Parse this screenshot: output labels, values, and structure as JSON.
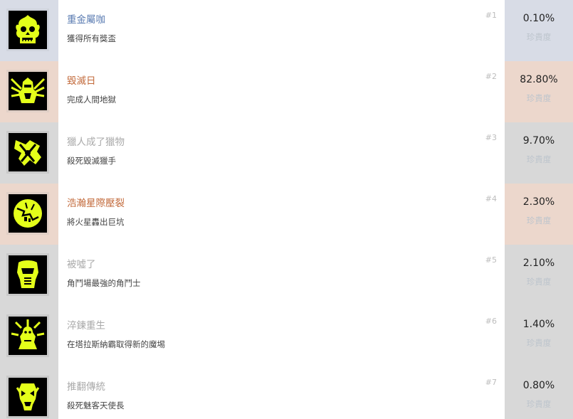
{
  "rarity_label": "珍貴度",
  "achievements": [
    {
      "rank": "#1",
      "title": "重金屬咖",
      "description": "獲得所有獎盃",
      "percent": "0.10%",
      "tier": 1,
      "icon": "flaming-skull-icon"
    },
    {
      "rank": "#2",
      "title": "毀滅日",
      "description": "完成人間地獄",
      "percent": "82.80%",
      "tier": 2,
      "icon": "slayer-emblem-icon"
    },
    {
      "rank": "#3",
      "title": "獵人成了獵物",
      "description": "殺死毀滅獵手",
      "percent": "9.70%",
      "tier": 0,
      "icon": "hunter-claw-icon"
    },
    {
      "rank": "#4",
      "title": "浩瀚星際壓裂",
      "description": "將火星轟出巨坑",
      "percent": "2.30%",
      "tier": 2,
      "icon": "cracked-planet-icon"
    },
    {
      "rank": "#5",
      "title": "被噓了",
      "description": "角鬥場最強的角鬥士",
      "percent": "2.10%",
      "tier": 0,
      "icon": "gladiator-helmet-icon"
    },
    {
      "rank": "#6",
      "title": "淬鍊重生",
      "description": "在塔拉斯納霸取得新的魔埸",
      "percent": "1.40%",
      "tier": 0,
      "icon": "reborn-idol-icon"
    },
    {
      "rank": "#7",
      "title": "推翻傳統",
      "description": "殺死魅客天使長",
      "percent": "0.80%",
      "tier": 0,
      "icon": "archvile-mask-icon"
    }
  ],
  "colors": {
    "icon_fill": "#e4ff1a",
    "tier_1_bg": "#d8dce6",
    "tier_2_bg": "#ecd7cc",
    "default_bg": "#d8d8d8"
  }
}
